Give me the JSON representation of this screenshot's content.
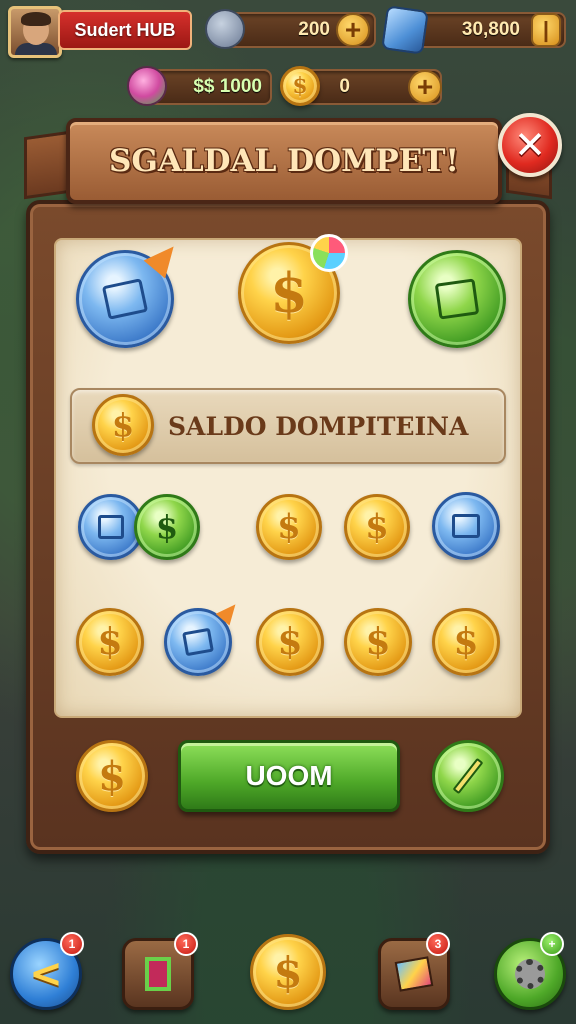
{
  "header": {
    "player_name": "Sudert HUB",
    "resource_1": "200",
    "resource_2": "30,800",
    "cash": "$$ 1000",
    "coins": "0",
    "plus_symbol": "+"
  },
  "dialog": {
    "title": "SGALDAL DOMPET!",
    "close_symbol": "✕",
    "saldo_label": "SALDO DOMPITEINA",
    "action_button": "UOOM"
  },
  "bottom_nav": {
    "back_badge": "1",
    "frame_badge": "1",
    "map_badge": "3",
    "settings_badge": "+"
  },
  "icons": {
    "currency_symbol": "$"
  },
  "colors": {
    "primary_green": "#4ea828",
    "close_red": "#e02a20",
    "wood_brown": "#7a4a2c",
    "coin_gold": "#ffd34a"
  }
}
